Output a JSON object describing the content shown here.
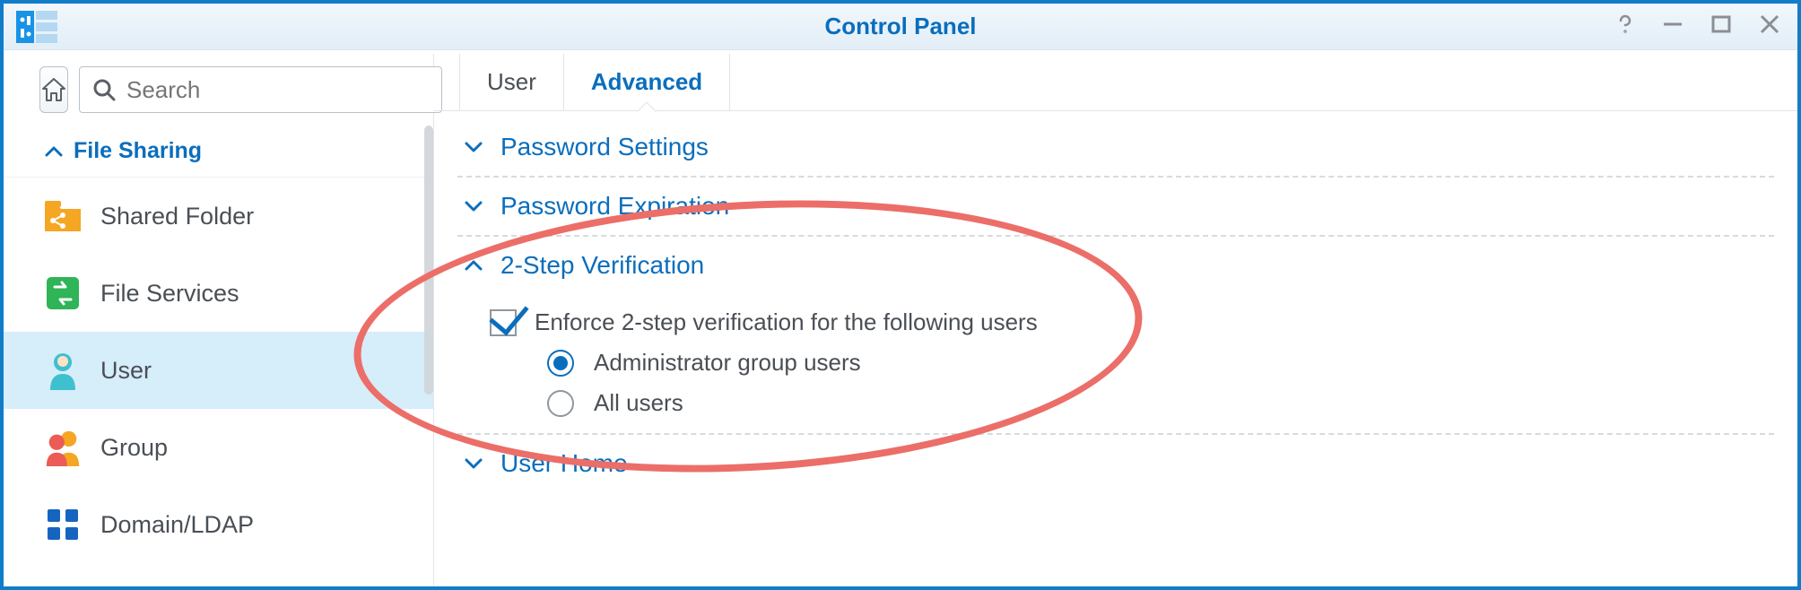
{
  "window": {
    "title": "Control Panel"
  },
  "sidebar": {
    "search_placeholder": "Search",
    "section_label": "File Sharing",
    "items": [
      {
        "label": "Shared Folder"
      },
      {
        "label": "File Services"
      },
      {
        "label": "User"
      },
      {
        "label": "Group"
      },
      {
        "label": "Domain/LDAP"
      }
    ]
  },
  "tabs": {
    "user": "User",
    "advanced": "Advanced"
  },
  "sections": {
    "password_settings": "Password Settings",
    "password_expiration": "Password Expiration",
    "two_step": "2-Step Verification",
    "user_home": "User Home"
  },
  "two_step": {
    "enforce_label": "Enforce 2-step verification for the following users",
    "enforce_checked": true,
    "radio_admin": "Administrator group users",
    "radio_all": "All users",
    "radio_selected": "admin"
  }
}
